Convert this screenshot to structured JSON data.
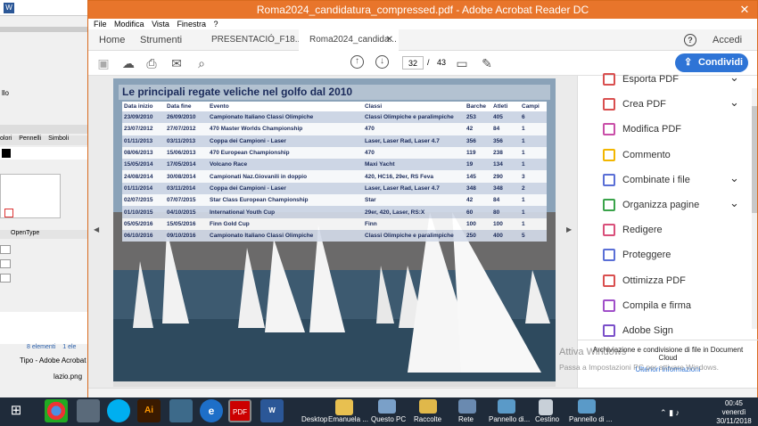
{
  "window": {
    "title": "Roma2024_candidatura_compressed.pdf - Adobe Acrobat Reader DC"
  },
  "menu": [
    "File",
    "Modifica",
    "Vista",
    "Finestra",
    "?"
  ],
  "tabs": {
    "home": "Home",
    "tools": "Strumenti",
    "tab1": "PRESENTACIÓ_F18...",
    "tab2": "Roma2024_candida...",
    "login": "Accedi"
  },
  "toolbar": {
    "page_current": "32",
    "page_sep": "/",
    "page_total": "43",
    "share": "Condividi"
  },
  "slide": {
    "title": "Le principali regate veliche nel golfo dal 2010",
    "headers": [
      "Data inizio",
      "Data fine",
      "Evento",
      "Classi",
      "Barche",
      "Atleti",
      "Campi"
    ],
    "rows": [
      [
        "23/09/2010",
        "26/09/2010",
        "Campionato Italiano Classi Olimpiche",
        "Classi Olimpiche e paralimpiche",
        "253",
        "405",
        "6"
      ],
      [
        "23/07/2012",
        "27/07/2012",
        "470 Master Worlds Championship",
        "470",
        "42",
        "84",
        "1"
      ],
      [
        "01/11/2013",
        "03/11/2013",
        "Coppa dei Campioni - Laser",
        "Laser, Laser Rad, Laser 4.7",
        "356",
        "356",
        "1"
      ],
      [
        "08/06/2013",
        "15/06/2013",
        "470 European Championship",
        "470",
        "119",
        "238",
        "1"
      ],
      [
        "15/05/2014",
        "17/05/2014",
        "Volcano Race",
        "Maxi Yacht",
        "19",
        "134",
        "1"
      ],
      [
        "24/08/2014",
        "30/08/2014",
        "Campionati Naz.Giovanili in doppio",
        "420, HC16, 29er, RS Feva",
        "145",
        "290",
        "3"
      ],
      [
        "01/11/2014",
        "03/11/2014",
        "Coppa dei Campioni - Laser",
        "Laser, Laser Rad, Laser 4.7",
        "348",
        "348",
        "2"
      ],
      [
        "02/07/2015",
        "07/07/2015",
        "Star Class European Championship",
        "Star",
        "42",
        "84",
        "1"
      ],
      [
        "01/10/2015",
        "04/10/2015",
        "International Youth Cup",
        "29er, 420, Laser, RS:X",
        "60",
        "80",
        "1"
      ],
      [
        "05/05/2016",
        "15/05/2016",
        "Finn Gold Cup",
        "Finn",
        "100",
        "100",
        "1"
      ],
      [
        "06/10/2016",
        "09/10/2016",
        "Campionato Italiano Classi Olimpiche",
        "Classi Olimpiche e paralimpiche",
        "250",
        "400",
        "5"
      ]
    ]
  },
  "tools": [
    {
      "label": "Esporta PDF",
      "icon": "export-pdf-icon",
      "color": "#d94f4f",
      "chev": true
    },
    {
      "label": "Crea PDF",
      "icon": "create-pdf-icon",
      "color": "#d94f4f",
      "chev": true
    },
    {
      "label": "Modifica PDF",
      "icon": "edit-pdf-icon",
      "color": "#c94ea8",
      "chev": false
    },
    {
      "label": "Commento",
      "icon": "comment-icon",
      "color": "#f2b600",
      "chev": false
    },
    {
      "label": "Combinate i file",
      "icon": "combine-files-icon",
      "color": "#5a6fd6",
      "chev": true
    },
    {
      "label": "Organizza pagine",
      "icon": "organize-pages-icon",
      "color": "#3aa34a",
      "chev": true
    },
    {
      "label": "Redigere",
      "icon": "redact-icon",
      "color": "#d94f7a",
      "chev": false
    },
    {
      "label": "Proteggere",
      "icon": "protect-icon",
      "color": "#5a6fd6",
      "chev": false
    },
    {
      "label": "Ottimizza PDF",
      "icon": "optimize-pdf-icon",
      "color": "#d94f4f",
      "chev": false
    },
    {
      "label": "Compila e firma",
      "icon": "fill-sign-icon",
      "color": "#a04fc9",
      "chev": false
    },
    {
      "label": "Adobe Sign",
      "icon": "adobe-sign-icon",
      "color": "#7a4fc9",
      "chev": false
    }
  ],
  "cloud": {
    "text": "Archiviazione e condivisione di file in Document Cloud",
    "link": "Ulteriori informazioni"
  },
  "watermark": {
    "line1": "Attiva Windows",
    "line2": "Passa a Impostazioni PC per attivare Windows."
  },
  "bgapp": {
    "items": "8 elementi",
    "items2": "1 ele",
    "type": "Tipo - Adobe Acrobat",
    "file": "lazio.png",
    "tab_a": "olori",
    "tab_b": "Pennelli",
    "tab_c": "Simboli",
    "opentype": "OpenType",
    "llo": "llo"
  },
  "taskbar": {
    "labels": [
      "Desktop",
      "Emanuela ...",
      "Questo PC",
      "Raccolte",
      "Rete",
      "Pannello di...",
      "Cestino",
      "Pannello di ..."
    ],
    "time": "00:45",
    "day": "venerdì",
    "date": "30/11/2018"
  }
}
